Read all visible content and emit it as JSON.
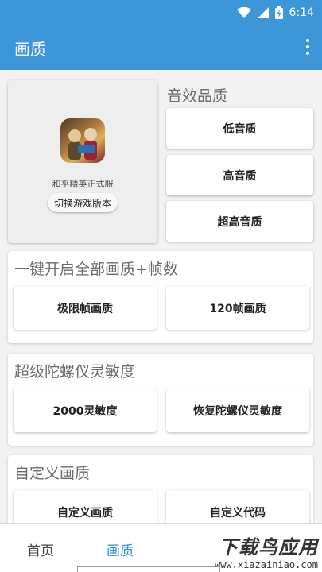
{
  "status": {
    "time": "6:14"
  },
  "appbar": {
    "title": "画质"
  },
  "game": {
    "name": "和平精英正式服",
    "switch_label": "切换游戏版本"
  },
  "audio": {
    "title": "音效品质",
    "buttons": [
      "低音质",
      "高音质",
      "超高音质"
    ]
  },
  "oneclick": {
    "title": "一键开启全部画质+帧数",
    "buttons": [
      "极限帧画质",
      "120帧画质"
    ]
  },
  "gyro": {
    "title": "超级陀螺仪灵敏度",
    "buttons": [
      "2000灵敏度",
      "恢复陀螺仪灵敏度"
    ]
  },
  "custom": {
    "title": "自定义画质",
    "buttons": [
      "自定义画质",
      "自定义代码"
    ]
  },
  "nav": {
    "home": "首页",
    "quality": "画质"
  },
  "watermark": {
    "title": "下载鸟应用",
    "url": "www.xiazainiao.com"
  },
  "colors": {
    "primary": "#3d96d8",
    "nav_active": "#2e8ee0"
  }
}
